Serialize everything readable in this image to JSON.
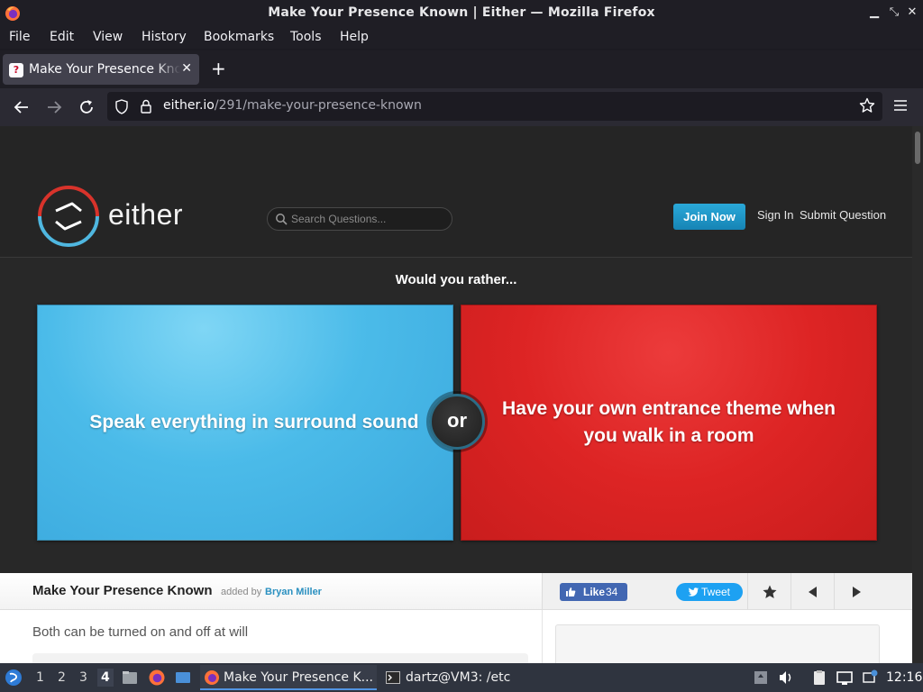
{
  "window": {
    "title": "Make Your Presence Known | Either — Mozilla Firefox",
    "controls": [
      "minimize",
      "maximize",
      "close"
    ]
  },
  "menu": [
    "File",
    "Edit",
    "View",
    "History",
    "Bookmarks",
    "Tools",
    "Help"
  ],
  "tab": {
    "title": "Make Your Presence Known | Either",
    "favicon_glyph": "?",
    "close_glyph": "✕"
  },
  "newtab_glyph": "+",
  "url": {
    "domain": "either.io",
    "path": "/291/make-your-presence-known"
  },
  "site": {
    "logo_text": "either",
    "search_placeholder": "Search Questions...",
    "join_label": "Join Now",
    "signin_label": "Sign In",
    "submit_label": "Submit Question",
    "prompt": "Would you rather...",
    "choice_a": "Speak everything in surround sound",
    "choice_b": "Have your own entrance theme when you walk in a room",
    "or_label": "or",
    "question_title": "Make Your Presence Known",
    "added_by": "added by",
    "author": "Bryan Miller",
    "description": "Both can be turned on and off at will",
    "like_label": "Like",
    "like_count": "34",
    "tweet_label": "Tweet"
  },
  "colors": {
    "choice_a": "#4bbbe9",
    "choice_b": "#dd2424",
    "join": "#1d95c9"
  },
  "taskbar": {
    "workspaces": [
      "1",
      "2",
      "3",
      "4"
    ],
    "active_workspace": "4",
    "firefox_task": "Make Your Presence K...",
    "terminal_task": "dartz@VM3: /etc",
    "clock": "12:16"
  }
}
